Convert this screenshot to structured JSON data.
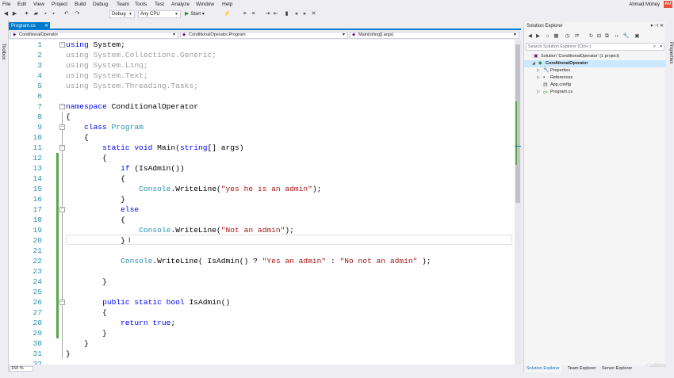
{
  "menu": [
    "File",
    "Edit",
    "View",
    "Project",
    "Build",
    "Debug",
    "Team",
    "Tools",
    "Test",
    "Analyze",
    "Window",
    "Help"
  ],
  "user": {
    "name": "Ahmad Mohey",
    "initials": "AM"
  },
  "toolbar": {
    "config": "Debug",
    "platform": "Any CPU",
    "start_label": "Start"
  },
  "toolbox_label": "Toolbox",
  "properties_label": "Properties",
  "editor": {
    "tab_name": "Program.cs",
    "nav": {
      "project": "ConditionalOperator",
      "class": "ConditionalOperator.Program",
      "member": "Main(string[] args)"
    },
    "zoom": "150 %",
    "lines": [
      {
        "n": "1",
        "toks": [
          [
            "kw",
            "using"
          ],
          [
            "tx",
            " System;"
          ]
        ]
      },
      {
        "n": "2",
        "toks": [
          [
            "fade",
            "using System.Collections.Generic;"
          ]
        ]
      },
      {
        "n": "3",
        "toks": [
          [
            "fade",
            "using System.Linq;"
          ]
        ]
      },
      {
        "n": "4",
        "toks": [
          [
            "fade",
            "using System.Text;"
          ]
        ]
      },
      {
        "n": "5",
        "toks": [
          [
            "fade",
            "using System.Threading.Tasks;"
          ]
        ]
      },
      {
        "n": "6",
        "toks": []
      },
      {
        "n": "7",
        "toks": [
          [
            "kw",
            "namespace"
          ],
          [
            "tx",
            " ConditionalOperator"
          ]
        ]
      },
      {
        "n": "8",
        "toks": [
          [
            "tx",
            "{"
          ]
        ]
      },
      {
        "n": "9",
        "toks": [
          [
            "tx",
            "    "
          ],
          [
            "kw",
            "class"
          ],
          [
            "tx",
            " "
          ],
          [
            "ty",
            "Program"
          ]
        ]
      },
      {
        "n": "10",
        "toks": [
          [
            "tx",
            "    {"
          ]
        ]
      },
      {
        "n": "11",
        "toks": [
          [
            "tx",
            "        "
          ],
          [
            "kw",
            "static void"
          ],
          [
            "tx",
            " Main("
          ],
          [
            "kw",
            "string"
          ],
          [
            "tx",
            "[] args)"
          ]
        ]
      },
      {
        "n": "12",
        "toks": [
          [
            "tx",
            "        {"
          ]
        ]
      },
      {
        "n": "13",
        "toks": [
          [
            "tx",
            "            "
          ],
          [
            "kw",
            "if"
          ],
          [
            "tx",
            " (IsAdmin())"
          ]
        ]
      },
      {
        "n": "14",
        "toks": [
          [
            "tx",
            "            {"
          ]
        ]
      },
      {
        "n": "15",
        "toks": [
          [
            "tx",
            "                "
          ],
          [
            "ty",
            "Console"
          ],
          [
            "tx",
            ".WriteLine("
          ],
          [
            "st",
            "\"yes he is an admin\""
          ],
          [
            "tx",
            ");"
          ]
        ]
      },
      {
        "n": "16",
        "toks": [
          [
            "tx",
            "            }"
          ]
        ]
      },
      {
        "n": "17",
        "toks": [
          [
            "tx",
            "            "
          ],
          [
            "kw",
            "else"
          ]
        ]
      },
      {
        "n": "18",
        "toks": [
          [
            "tx",
            "            {"
          ]
        ]
      },
      {
        "n": "19",
        "toks": [
          [
            "tx",
            "                "
          ],
          [
            "ty",
            "Console"
          ],
          [
            "tx",
            ".WriteLine("
          ],
          [
            "st",
            "\"Not an admin\""
          ],
          [
            "tx",
            ");"
          ]
        ]
      },
      {
        "n": "20",
        "toks": [
          [
            "tx",
            "            }"
          ]
        ]
      },
      {
        "n": "21",
        "toks": []
      },
      {
        "n": "22",
        "toks": [
          [
            "tx",
            "            "
          ],
          [
            "ty",
            "Console"
          ],
          [
            "tx",
            ".WriteLine( IsAdmin() ? "
          ],
          [
            "st",
            "\"Yes an admin\""
          ],
          [
            "tx",
            " : "
          ],
          [
            "st",
            "\"No not an admin\""
          ],
          [
            "tx",
            " );"
          ]
        ]
      },
      {
        "n": "23",
        "toks": []
      },
      {
        "n": "24",
        "toks": [
          [
            "tx",
            "        }"
          ]
        ]
      },
      {
        "n": "25",
        "toks": []
      },
      {
        "n": "26",
        "toks": [
          [
            "tx",
            "        "
          ],
          [
            "kw",
            "public static bool"
          ],
          [
            "tx",
            " IsAdmin()"
          ]
        ]
      },
      {
        "n": "27",
        "toks": [
          [
            "tx",
            "        {"
          ]
        ]
      },
      {
        "n": "28",
        "toks": [
          [
            "tx",
            "            "
          ],
          [
            "kw",
            "return true"
          ],
          [
            "tx",
            ";"
          ]
        ]
      },
      {
        "n": "29",
        "toks": [
          [
            "tx",
            "        }"
          ]
        ]
      },
      {
        "n": "30",
        "toks": [
          [
            "tx",
            "    }"
          ]
        ]
      },
      {
        "n": "31",
        "toks": [
          [
            "tx",
            "}"
          ]
        ]
      },
      {
        "n": "32",
        "toks": []
      }
    ]
  },
  "solution_explorer": {
    "title": "Solution Explorer",
    "search_placeholder": "Search Solution Explorer (Ctrl+;)",
    "tree": [
      {
        "label": "Solution 'ConditionalOperator' (1 project)",
        "level": 0,
        "icon": "solution-icon"
      },
      {
        "label": "ConditionalOperator",
        "level": 1,
        "icon": "csharp-project-icon",
        "selected": true
      },
      {
        "label": "Properties",
        "level": 2,
        "icon": "wrench-icon"
      },
      {
        "label": "References",
        "level": 2,
        "icon": "references-icon"
      },
      {
        "label": "App.config",
        "level": 2,
        "icon": "config-file-icon"
      },
      {
        "label": "Program.cs",
        "level": 2,
        "icon": "csharp-file-icon"
      }
    ],
    "tabs": [
      "Solution Explorer",
      "Team Explorer",
      "Server Explorer"
    ]
  }
}
